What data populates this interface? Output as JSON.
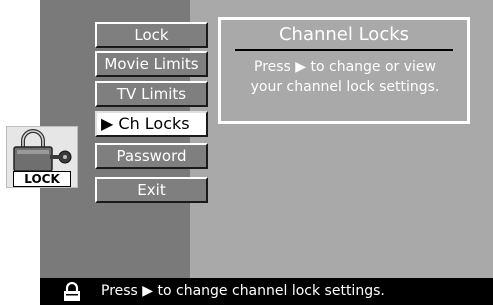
{
  "menu": {
    "items": [
      {
        "label": "Lock"
      },
      {
        "label": "Movie Limits"
      },
      {
        "label": "TV Limits"
      },
      {
        "label": "▶ Ch Locks",
        "selected": true
      },
      {
        "label": "Password"
      },
      {
        "label": "Exit"
      }
    ]
  },
  "panel": {
    "title": "Channel Locks",
    "line1": "Press ▶ to change or view",
    "line2": "your channel lock settings."
  },
  "lock_badge": {
    "label": "LOCK",
    "icon": "padlock-with-key-icon"
  },
  "status_bar": {
    "text": "Press ▶ to change channel lock settings.",
    "icon": "padlock-icon"
  },
  "colors": {
    "left_bg": "#7a7a7a",
    "right_bg": "#a9a9a9",
    "button_bg": "#7f7f7f",
    "selected_bg": "#ffffff",
    "status_bg": "#000000"
  }
}
